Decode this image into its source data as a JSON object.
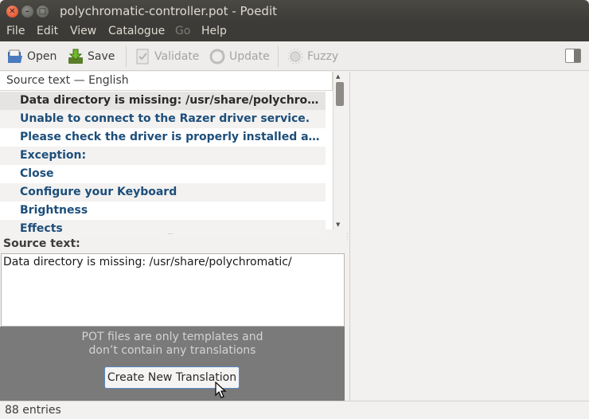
{
  "window": {
    "title": "polychromatic-controller.pot - Poedit",
    "close_glyph": "✕",
    "min_glyph": "–",
    "max_glyph": "□"
  },
  "menubar": {
    "items": [
      "File",
      "Edit",
      "View",
      "Catalogue",
      "Go",
      "Help"
    ]
  },
  "toolbar": {
    "open": "Open",
    "save": "Save",
    "validate": "Validate",
    "update": "Update",
    "fuzzy": "Fuzzy"
  },
  "list": {
    "header": "Source text — English",
    "rows": [
      "Data directory is missing: /usr/share/polychromatic/",
      "Unable to connect to the Razer driver service.",
      "Please check the driver is properly installed and t…",
      "Exception:",
      "Close",
      "Configure your Keyboard",
      "Brightness",
      "Effects"
    ]
  },
  "source": {
    "label": "Source text:",
    "text": "Data directory is missing: /usr/share/polychromatic/"
  },
  "pot": {
    "line1": "POT files are only templates and",
    "line2": "don’t contain any translations",
    "button": "Create New Translation"
  },
  "status": {
    "entries": "88 entries"
  },
  "colors": {
    "entry_text": "#1d4e7a",
    "pot_background": "#7a7a7a",
    "titlebar": "#3c3b37"
  }
}
